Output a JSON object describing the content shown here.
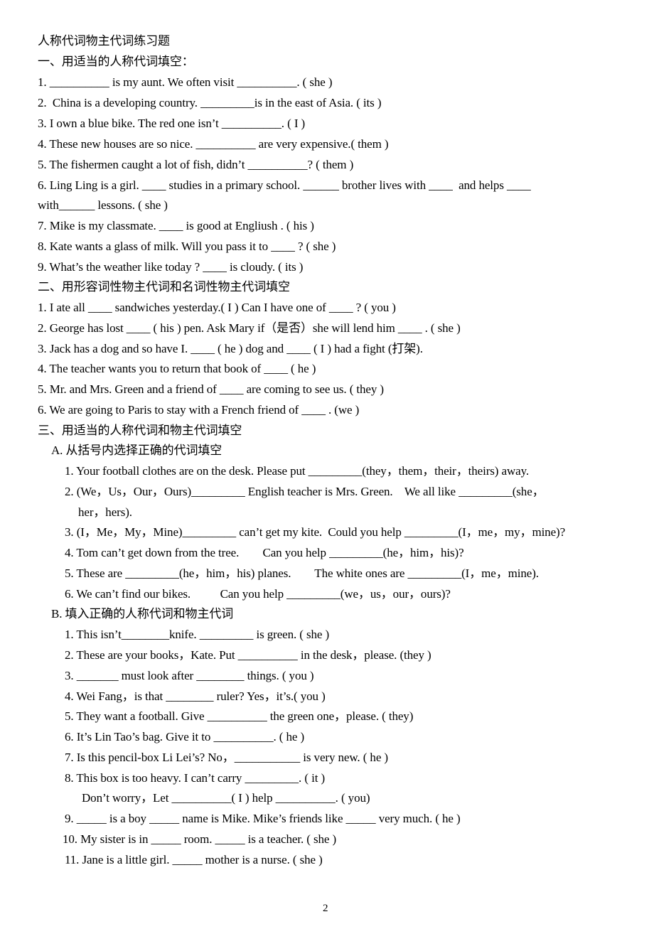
{
  "document": {
    "title": "人称代词物主代词练习题",
    "page_number": "2",
    "sections": [
      {
        "heading": "一、用适当的人称代词填空：",
        "items": [
          "1. __________ is my aunt. We often visit __________. ( she )",
          "2.  China is a developing country. _________is in the east of Asia. ( its )",
          "3. I own a blue bike. The red one isn’t __________. ( I )",
          "4. These new houses are so nice. __________ are very expensive.( them )",
          "5. The fishermen caught a lot of fish, didn’t __________? ( them )",
          "6. Ling Ling is a girl. ____ studies in a primary school. ______ brother lives with ____  and helps ____",
          "with______ lessons. ( she )",
          "7. Mike is my classmate. ____ is good at Engliush . ( his )",
          "8. Kate wants a glass of milk. Will you pass it to ____ ? ( she )",
          "9. What’s the weather like today ? ____ is cloudy. ( its )"
        ]
      },
      {
        "heading": "二、用形容词性物主代词和名词性物主代词填空",
        "items": [
          "1. I ate all ____ sandwiches yesterday.( I ) Can I have one of ____ ? ( you )",
          "2. George has lost ____ ( his ) pen. Ask Mary if（是否）she will lend him ____ . ( she )",
          "3. Jack has a dog and so have I. ____ ( he ) dog and ____ ( I ) had a fight (打架).",
          "4. The teacher wants you to return that book of ____ ( he )",
          "5. Mr. and Mrs. Green and a friend of ____ are coming to see us. ( they )",
          "6. We are going to Paris to stay with a French friend of ____ . (we )"
        ]
      },
      {
        "heading": "三、用适当的人称代词和物主代词填空",
        "part_a": {
          "heading": "A. 从括号内选择正确的代词填空",
          "items": [
            "1. Your football clothes are on the desk. Please put _________(they，them，their，theirs) away.",
            "2. (We，Us，Our，Ours)_________ English teacher is Mrs. Green.    We all like _________(she，",
            "her，hers).",
            "3. (I，Me，My，Mine)_________ can’t get my kite.  Could you help _________(I，me，my，mine)?",
            "4. Tom can’t get down from the tree.        Can you help _________(he，him，his)?",
            "5. These are _________(he，him，his) planes.        The white ones are _________(I，me，mine).",
            "6. We can’t find our bikes.          Can you help _________(we，us，our，ours)?"
          ]
        },
        "part_b": {
          "heading": "B. 填入正确的人称代词和物主代词",
          "items": [
            "1. This isn’t________knife. _________ is green. ( she )",
            "2. These are your books，Kate. Put __________ in the desk，please. (they )",
            "3. _______ must look after ________ things. ( you )",
            "4. Wei Fang，is that ________ ruler? Yes，it’s.( you )",
            "5. They want a football. Give __________ the green one，please. ( they)",
            "6. It’s Lin Tao’s bag. Give it to __________. ( he )",
            "7. Is this pencil-box Li Lei’s? No，___________ is very new. ( he )",
            "8. This box is too heavy. I can’t carry _________. ( it )",
            "Don’t worry，Let __________( I ) help __________. ( you)",
            "9. _____ is a boy _____ name is Mike. Mike’s friends like _____ very much. ( he )",
            "10. My sister is in _____ room. _____ is a teacher. ( she )",
            "11. Jane is a little girl. _____ mother is a nurse. ( she )"
          ]
        }
      }
    ]
  }
}
